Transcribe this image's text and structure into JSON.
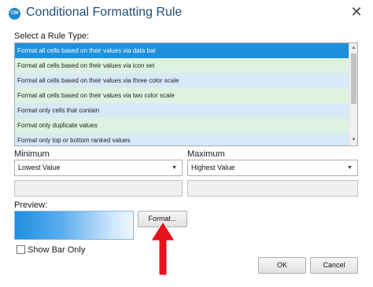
{
  "window": {
    "title": "Conditional Formatting Rule",
    "icon": "app-logo-icon",
    "icon_text": "CM",
    "close_glyph": "✕"
  },
  "rule_type": {
    "label": "Select a Rule Type:",
    "items": [
      {
        "label": "Format all cells based on their values via data bar",
        "selected": true
      },
      {
        "label": "Format all cells based on their values via icon set"
      },
      {
        "label": "Format all cells based on their values via three color scale"
      },
      {
        "label": "Format all cells based on their values via two color scale"
      },
      {
        "label": "Format only cells that contain"
      },
      {
        "label": "Format only duplicate values"
      },
      {
        "label": "Format only top or bottom ranked values"
      }
    ]
  },
  "minimum": {
    "label": "Minimum",
    "value": "Lowest Value"
  },
  "maximum": {
    "label": "Maximum",
    "value": "Highest Value"
  },
  "preview": {
    "label": "Preview:",
    "format_button": "Format...",
    "show_bar_only": "Show Bar Only",
    "show_bar_only_checked": false
  },
  "buttons": {
    "ok": "OK",
    "cancel": "Cancel"
  },
  "colors": {
    "accent": "#1e90dc",
    "title": "#1f4e79",
    "annotation_arrow": "#e8121d"
  }
}
